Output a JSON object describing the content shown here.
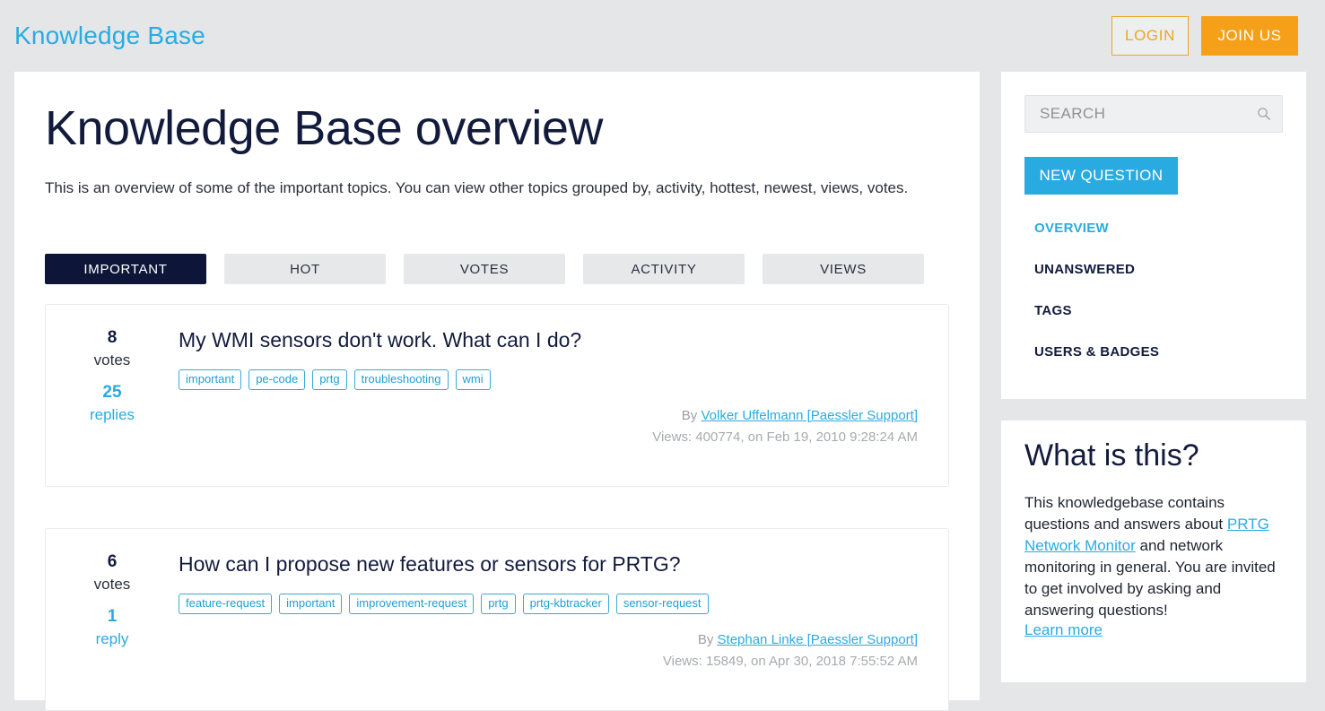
{
  "header": {
    "brand": "Knowledge Base",
    "login_label": "LOGIN",
    "join_label": "JOIN US"
  },
  "main": {
    "title": "Knowledge Base overview",
    "description": "This is an overview of some of the important topics. You can view other topics grouped by, activity, hottest, newest, views, votes.",
    "tabs": [
      {
        "label": "IMPORTANT",
        "active": true
      },
      {
        "label": "HOT",
        "active": false
      },
      {
        "label": "VOTES",
        "active": false
      },
      {
        "label": "ACTIVITY",
        "active": false
      },
      {
        "label": "VIEWS",
        "active": false
      }
    ],
    "questions": [
      {
        "votes": "8",
        "votes_label": "votes",
        "replies": "25",
        "replies_label": "replies",
        "title": "My WMI sensors don't work. What can I do?",
        "tags": [
          "important",
          "pe-code",
          "prtg",
          "troubleshooting",
          "wmi"
        ],
        "by_prefix": "By",
        "author": "Volker Uffelmann [Paessler Support]",
        "views_line": "Views: 400774, on Feb 19, 2010 9:28:24 AM"
      },
      {
        "votes": "6",
        "votes_label": "votes",
        "replies": "1",
        "replies_label": "reply",
        "title": "How can I propose new features or sensors for PRTG?",
        "tags": [
          "feature-request",
          "important",
          "improvement-request",
          "prtg",
          "prtg-kbtracker",
          "sensor-request"
        ],
        "by_prefix": "By",
        "author": "Stephan Linke [Paessler Support]",
        "views_line": "Views: 15849, on Apr 30, 2018 7:55:52 AM"
      }
    ]
  },
  "sidebar": {
    "search": {
      "value": "",
      "placeholder": "SEARCH",
      "icon": "search-icon"
    },
    "new_question_label": "NEW QUESTION",
    "links": [
      {
        "label": "OVERVIEW",
        "active": true
      },
      {
        "label": "UNANSWERED",
        "active": false
      },
      {
        "label": "TAGS",
        "active": false
      },
      {
        "label": "USERS & BADGES",
        "active": false
      }
    ],
    "about": {
      "title": "What is this?",
      "text_before": "This knowledgebase contains questions and answers about ",
      "link": "PRTG Network Monitor",
      "text_after": " and network monitoring in general. You are invited to get involved by asking and answering questions!",
      "learn_more": "Learn more"
    }
  },
  "colors": {
    "brand_blue": "#29abe2",
    "navy": "#131b3d",
    "orange": "#f6a01a",
    "page_bg": "#e4e6e8"
  }
}
